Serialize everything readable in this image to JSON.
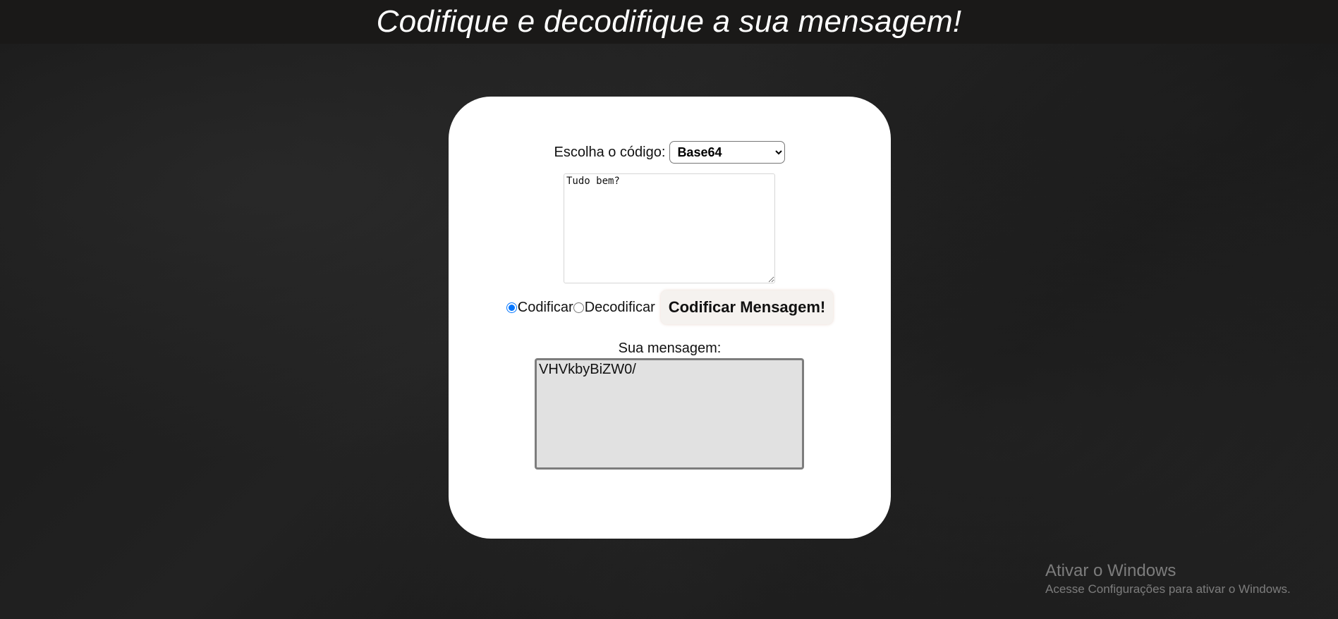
{
  "header": {
    "title": "Codifique e decodifique a sua mensagem!"
  },
  "form": {
    "select_label": "Escolha o código:",
    "select_value": "Base64",
    "input_text": "Tudo bem?",
    "radio_encode": "Codificar",
    "radio_decode": "Decodificar",
    "selected_mode": "Codificar",
    "action_button": "Codificar Mensagem!"
  },
  "result": {
    "label": "Sua mensagem:",
    "text": "VHVkbyBiZW0/"
  },
  "watermark": {
    "title": "Ativar o Windows",
    "subtitle": "Acesse Configurações para ativar o Windows."
  },
  "colors": {
    "header_bg": "#1a1918",
    "card_bg": "#ffffff",
    "result_bg": "#e1e1e1",
    "radio_accent": "#0075ff"
  }
}
